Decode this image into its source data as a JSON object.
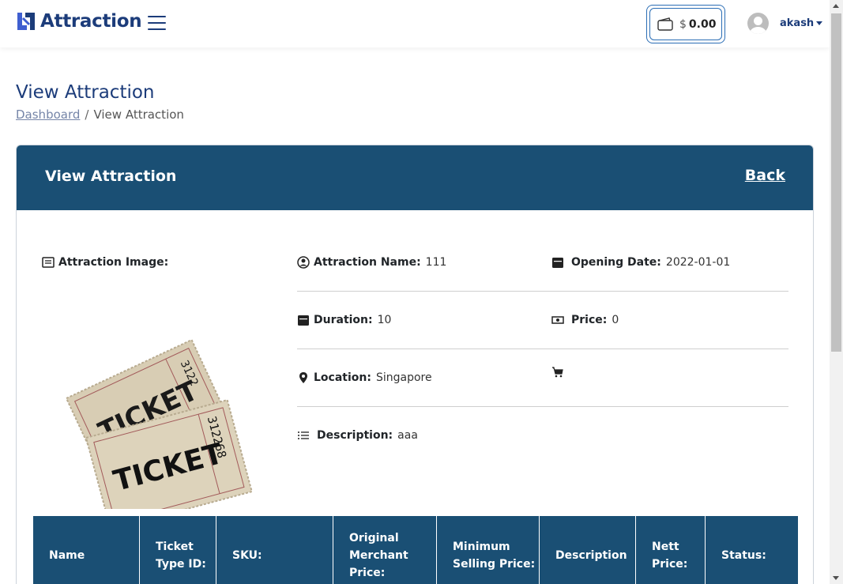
{
  "navbar": {
    "brand": "Attraction",
    "wallet": {
      "currency": "$",
      "amount": "0.00"
    },
    "user": {
      "name": "akash"
    }
  },
  "page": {
    "title": "View Attraction",
    "breadcrumb": {
      "home": "Dashboard",
      "separator": "/",
      "current": "View Attraction"
    }
  },
  "card": {
    "title": "View Attraction",
    "back": "Back",
    "image_label": "Attraction Image:",
    "fields": {
      "name": {
        "label": "Attraction Name:",
        "value": "111"
      },
      "opening_date": {
        "label": "Opening Date:",
        "value": "2022-01-01"
      },
      "duration": {
        "label": "Duration:",
        "value": "10"
      },
      "price": {
        "label": "Price:",
        "value": "0"
      },
      "location": {
        "label": "Location:",
        "value": "Singapore"
      },
      "description": {
        "label": "Description:",
        "value": "aaa"
      }
    }
  },
  "table": {
    "headers": [
      "Name",
      "Ticket Type ID:",
      "SKU:",
      "Original Merchant Price:",
      "Minimum Selling Price:",
      "Description",
      "Nett Price:",
      "Status:"
    ]
  },
  "image": {
    "ticket_front_text": "TICKET",
    "ticket_front_number": "312268",
    "ticket_back_text": "TICKET",
    "ticket_back_number": "3122"
  },
  "colors": {
    "primary_dark": "#1a4f74",
    "brand": "#1c3c7a",
    "wallet_border": "#2a6db5"
  }
}
